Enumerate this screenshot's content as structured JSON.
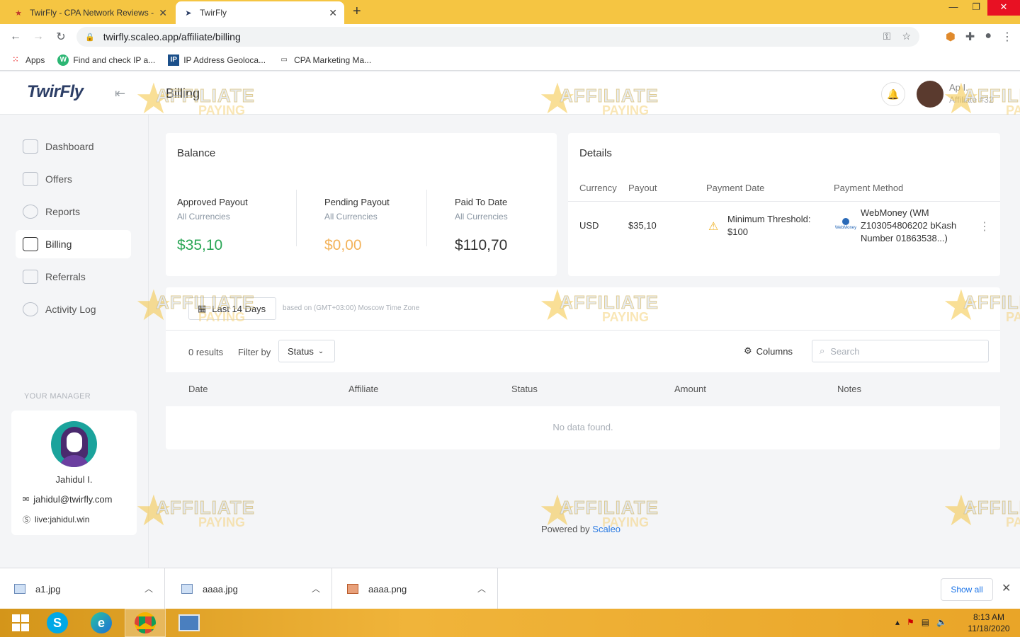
{
  "browser": {
    "tabs": [
      {
        "title": "TwirFly - CPA Network Reviews -",
        "active": false
      },
      {
        "title": "TwirFly",
        "active": true
      }
    ],
    "url": "twirfly.scaleo.app/affiliate/billing",
    "bookmarks": [
      "Apps",
      "Find and check IP a...",
      "IP Address Geoloca...",
      "CPA Marketing Ma..."
    ]
  },
  "header": {
    "logo": "TwirFly",
    "page_title": "Billing",
    "user_name": "Ap I.",
    "user_id": "Affiliate #32"
  },
  "sidebar": {
    "items": [
      {
        "label": "Dashboard",
        "active": false
      },
      {
        "label": "Offers",
        "active": false
      },
      {
        "label": "Reports",
        "active": false
      },
      {
        "label": "Billing",
        "active": true
      },
      {
        "label": "Referrals",
        "active": false
      },
      {
        "label": "Activity Log",
        "active": false
      }
    ],
    "manager_label": "YOUR MANAGER",
    "manager": {
      "name": "Jahidul I.",
      "email": "jahidul@twirfly.com",
      "skype": "live:jahidul.win"
    }
  },
  "balance": {
    "title": "Balance",
    "columns": [
      {
        "label": "Approved Payout",
        "sub": "All Currencies",
        "value": "$35,10",
        "color": "#2aa656"
      },
      {
        "label": "Pending Payout",
        "sub": "All Currencies",
        "value": "$0,00",
        "color": "#f3b35b"
      },
      {
        "label": "Paid To Date",
        "sub": "All Currencies",
        "value": "$110,70",
        "color": "#333333"
      }
    ]
  },
  "details": {
    "title": "Details",
    "headers": [
      "Currency",
      "Payout",
      "Payment Date",
      "Payment Method"
    ],
    "row": {
      "currency": "USD",
      "payout": "$35,10",
      "payment_date_line1": "Minimum Threshold:",
      "payment_date_line2": "$100",
      "method_line1": "WebMoney (WM",
      "method_line2": "Z103054806202 bKash",
      "method_line3": "Number 01863538...)",
      "method_logo_text": "WebMoney"
    }
  },
  "table": {
    "date_range": "Last 14 Days",
    "timezone_note": "based on (GMT+03:00) Moscow Time Zone",
    "results": "0 results",
    "filter_label": "Filter by",
    "status_filter": "Status",
    "columns_label": "Columns",
    "search_placeholder": "Search",
    "headers": [
      "Date",
      "Affiliate",
      "Status",
      "Amount",
      "Notes"
    ],
    "empty_text": "No data found."
  },
  "footer": {
    "powered_prefix": "Powered by",
    "powered_brand": "Scaleo"
  },
  "watermark": {
    "line1": "AFFILIATE",
    "line2": "PAYING"
  },
  "downloads": {
    "files": [
      "a1.jpg",
      "aaaa.jpg",
      "aaaa.png"
    ],
    "show_all": "Show all"
  },
  "taskbar": {
    "time": "8:13 AM",
    "date": "11/18/2020"
  }
}
